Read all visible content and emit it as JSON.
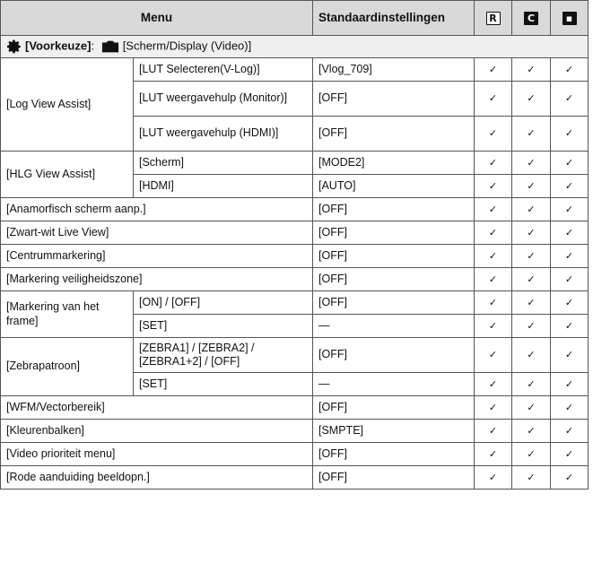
{
  "header": {
    "menu": "Menu",
    "defaults": "Standaardinstellingen",
    "icon1": "R",
    "icon2": "C",
    "icon3": "▪"
  },
  "section": {
    "group_label": "[Voorkeuze]",
    "separator": ":",
    "page_label": "[Scherm/Display (Video)]"
  },
  "check": "✓",
  "rows": {
    "log_view_assist": "[Log View Assist]",
    "lut_select": "[LUT Selecteren(V-Log)]",
    "lut_select_val": "[Vlog_709]",
    "lut_monitor": "[LUT weergavehulp (Monitor)]",
    "lut_monitor_val": "[OFF]",
    "lut_hdmi": "[LUT weergavehulp (HDMI)]",
    "lut_hdmi_val": "[OFF]",
    "hlg_view_assist": "[HLG View Assist]",
    "hlg_scherm": "[Scherm]",
    "hlg_scherm_val": "[MODE2]",
    "hlg_hdmi": "[HDMI]",
    "hlg_hdmi_val": "[AUTO]",
    "anamorf": "[Anamorfisch scherm aanp.]",
    "anamorf_val": "[OFF]",
    "zwartwit": "[Zwart-wit Live View]",
    "zwartwit_val": "[OFF]",
    "centrum": "[Centrummarkering]",
    "centrum_val": "[OFF]",
    "veiligheid": "[Markering veiligheidszone]",
    "veiligheid_val": "[OFF]",
    "frame": "[Markering van het frame]",
    "frame_onoff": "[ON] / [OFF]",
    "frame_onoff_val": "[OFF]",
    "frame_set": "[SET]",
    "frame_set_val": "—",
    "zebra": "[Zebrapatroon]",
    "zebra_opts": "[ZEBRA1] / [ZEBRA2] / [ZEBRA1+2] / [OFF]",
    "zebra_opts_val": "[OFF]",
    "zebra_set": "[SET]",
    "zebra_set_val": "—",
    "wfm": "[WFM/Vectorbereik]",
    "wfm_val": "[OFF]",
    "kleur": "[Kleurenbalken]",
    "kleur_val": "[SMPTE]",
    "prioriteit": "[Video prioriteit menu]",
    "prioriteit_val": "[OFF]",
    "rode": "[Rode aanduiding beeldopn.]",
    "rode_val": "[OFF]"
  }
}
